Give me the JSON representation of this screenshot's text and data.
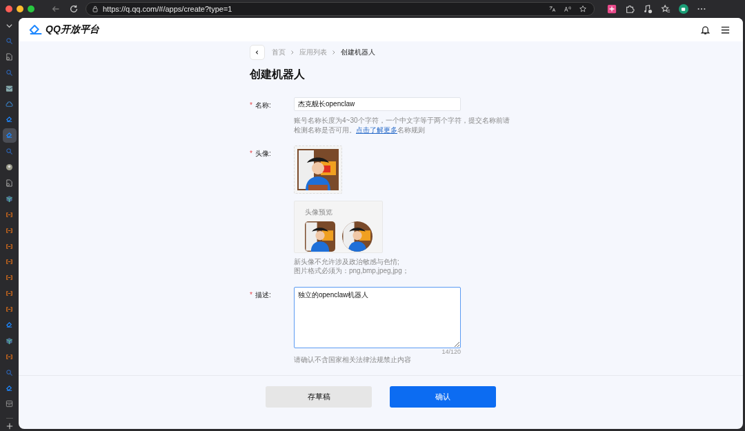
{
  "browser": {
    "url": "https://q.qq.com/#/apps/create?type=1"
  },
  "sidebar": {
    "items": [
      {
        "kind": "search",
        "selected": false
      },
      {
        "kind": "doc",
        "selected": false
      },
      {
        "kind": "search",
        "selected": false
      },
      {
        "kind": "mail",
        "selected": false
      },
      {
        "kind": "cloud",
        "selected": false
      },
      {
        "kind": "app",
        "selected": false
      },
      {
        "kind": "app",
        "selected": true
      },
      {
        "kind": "search",
        "selected": false
      },
      {
        "kind": "avatar",
        "selected": false
      },
      {
        "kind": "doc",
        "selected": false
      },
      {
        "kind": "cube",
        "selected": false
      },
      {
        "kind": "link",
        "selected": false
      },
      {
        "kind": "link",
        "selected": false
      },
      {
        "kind": "link",
        "selected": false
      },
      {
        "kind": "link",
        "selected": false
      },
      {
        "kind": "link",
        "selected": false
      },
      {
        "kind": "link",
        "selected": false
      },
      {
        "kind": "link",
        "selected": false
      },
      {
        "kind": "app",
        "selected": false
      },
      {
        "kind": "cube",
        "selected": false
      },
      {
        "kind": "link",
        "selected": false
      },
      {
        "kind": "search",
        "selected": false
      },
      {
        "kind": "app",
        "selected": false
      },
      {
        "kind": "sheet",
        "selected": false
      }
    ]
  },
  "header": {
    "logo": "QQ开放平台"
  },
  "breadcrumb": [
    "首页",
    "应用列表",
    "创建机器人"
  ],
  "title": "创建机器人",
  "form": {
    "name": {
      "required_mark": "*",
      "label": "名称:",
      "value": "杰克舰长openclaw",
      "hint_before": "账号名称长度为4~30个字符，一个中文字等于两个字符，提交名称前请检测名称是否可用。",
      "hint_link": "点击了解更多",
      "hint_after": "名称规则"
    },
    "avatar": {
      "required_mark": "*",
      "label": "头像:",
      "preview_title": "头像预览",
      "notes": [
        "新头像不允许涉及政治敏感与色情;",
        "图片格式必须为：png,bmp,jpeg,jpg；"
      ]
    },
    "description": {
      "required_mark": "*",
      "label": "描述:",
      "value": "独立的openclaw机器人",
      "counter": "14/120",
      "hint": "请确认不含国家相关法律法规禁止内容"
    }
  },
  "buttons": [
    {
      "label": "存草稿",
      "kind": "secondary"
    },
    {
      "label": "确认",
      "kind": "primary"
    }
  ]
}
